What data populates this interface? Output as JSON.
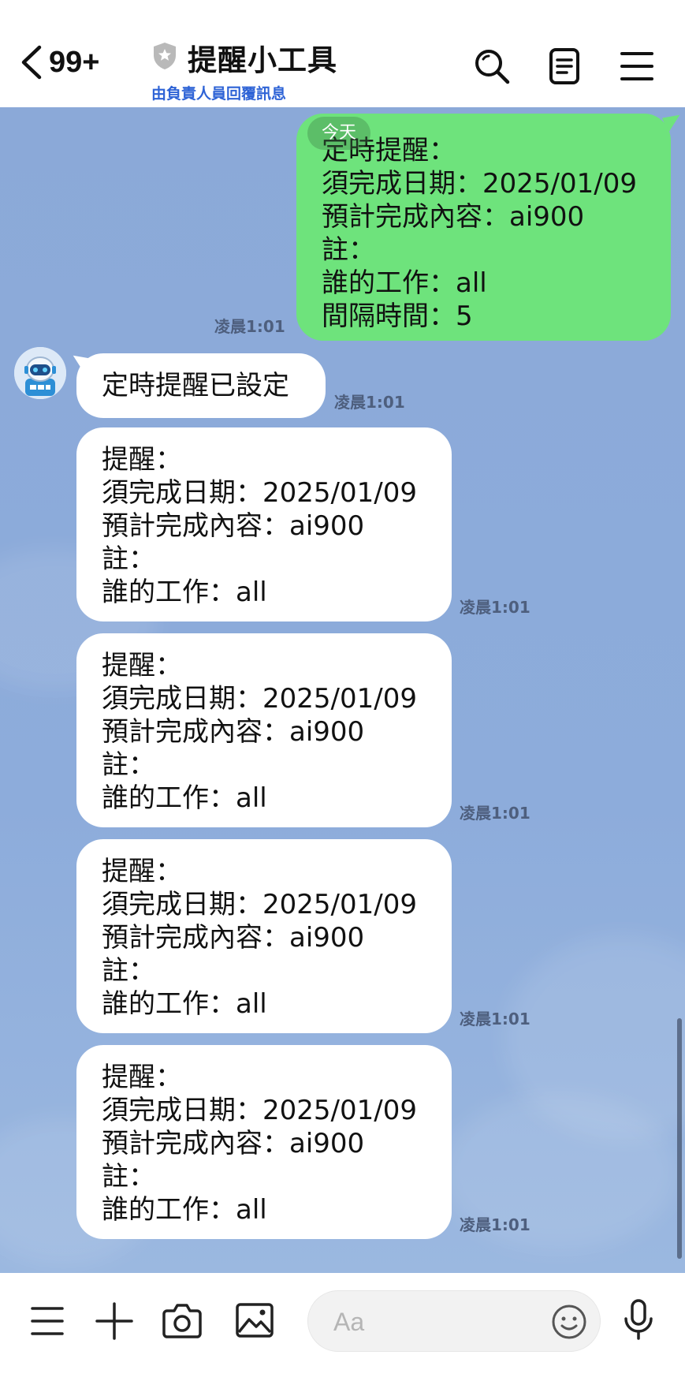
{
  "header": {
    "unread_count": "99+",
    "title": "提醒小工具",
    "subtitle": "由負責人員回覆訊息"
  },
  "chat": {
    "date_pill": "今天",
    "sent": {
      "lines": [
        "定時提醒：",
        "須完成日期：2025/01/09",
        "預計完成內容：ai900",
        "註：",
        "誰的工作：all",
        "間隔時間：5"
      ],
      "time": "凌晨1:01"
    },
    "confirm": {
      "text": "定時提醒已設定",
      "time": "凌晨1:01"
    },
    "reminders": [
      {
        "lines": [
          "提醒：",
          "須完成日期：2025/01/09",
          "預計完成內容：ai900",
          "註：",
          "誰的工作：all"
        ],
        "time": "凌晨1:01"
      },
      {
        "lines": [
          "提醒：",
          "須完成日期：2025/01/09",
          "預計完成內容：ai900",
          "註：",
          "誰的工作：all"
        ],
        "time": "凌晨1:01"
      },
      {
        "lines": [
          "提醒：",
          "須完成日期：2025/01/09",
          "預計完成內容：ai900",
          "註：",
          "誰的工作：all"
        ],
        "time": "凌晨1:01"
      },
      {
        "lines": [
          "提醒：",
          "須完成日期：2025/01/09",
          "預計完成內容：ai900",
          "註：",
          "誰的工作：all"
        ],
        "time": "凌晨1:01"
      }
    ]
  },
  "input": {
    "placeholder": "Aa"
  },
  "icons": {
    "back": "chevron-left-icon",
    "shield": "shield-icon",
    "search": "search-icon",
    "notes": "notes-icon",
    "menu": "menu-icon",
    "more": "hamburger-icon",
    "add": "plus-icon",
    "camera": "camera-icon",
    "image": "image-icon",
    "emoji": "emoji-icon",
    "mic": "microphone-icon"
  },
  "colors": {
    "sent_bubble": "#6ee37c",
    "received_bubble": "#ffffff",
    "chat_background": "#8ba9d8",
    "subtitle": "#2e63d6"
  }
}
